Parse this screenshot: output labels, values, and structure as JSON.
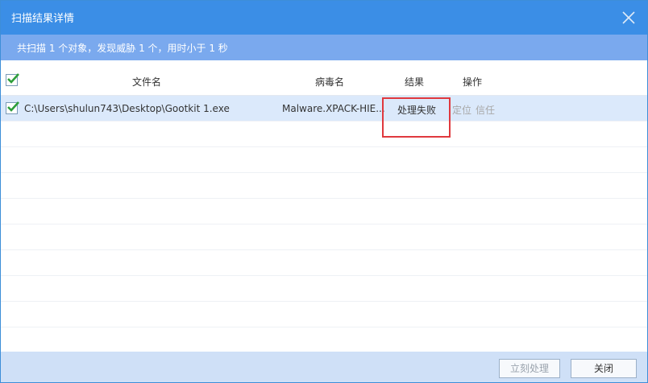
{
  "window": {
    "title": "扫描结果详情"
  },
  "summary": {
    "text": "共扫描 1 个对象，发现威胁 1 个，用时小于 1 秒"
  },
  "table": {
    "headers": {
      "filename": "文件名",
      "virus_name": "病毒名",
      "result": "结果",
      "action": "操作"
    },
    "rows": [
      {
        "checked": true,
        "filename": "C:\\Users\\shulun743\\Desktop\\Gootkit 1.exe",
        "virus_name": "Malware.XPACK-HIE...",
        "result": "处理失败",
        "actions": [
          "定位",
          "信任"
        ]
      }
    ]
  },
  "footer": {
    "process_now_label": "立刻处理",
    "close_label": "关闭"
  },
  "colors": {
    "titlebar": "#3b8ee6",
    "summary_bar": "#7aa9ee",
    "selected_row": "#dbe9fb",
    "highlight_border": "#e0393e",
    "check_green": "#2e9e3a"
  }
}
